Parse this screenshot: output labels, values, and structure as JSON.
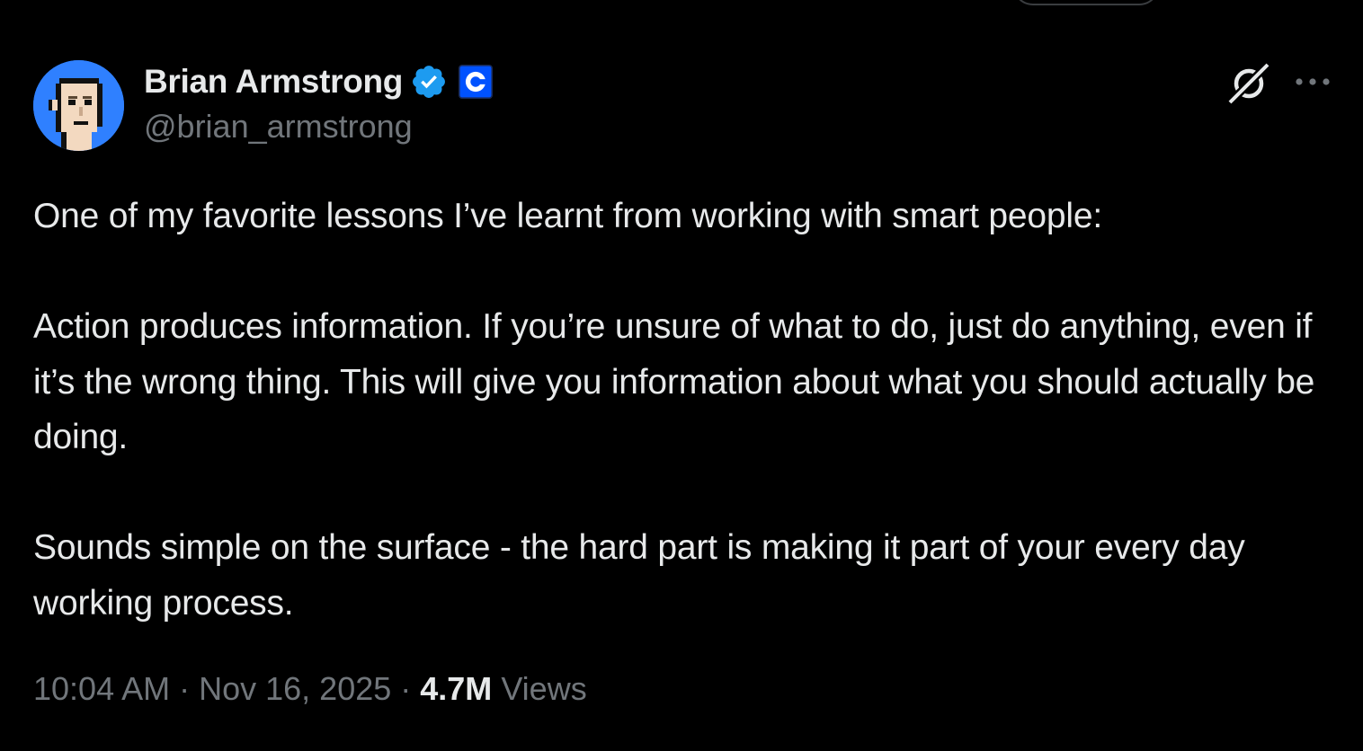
{
  "author": {
    "display_name": "Brian Armstrong",
    "handle": "@brian_armstrong",
    "verified_badge": "verified-badge-icon",
    "affiliate_badge": "coinbase-logo-icon",
    "avatar": "pixel-punk-avatar"
  },
  "actions": {
    "grok_icon": "grok-icon",
    "more_icon": "more-options-icon"
  },
  "tweet": {
    "paragraphs": [
      "One of my favorite lessons I’ve learnt from working with smart people:",
      "Action produces information. If you’re unsure of what to do, just do anything, even if it’s the wrong thing. This will give you information about what you should actually be doing.",
      "Sounds simple on the surface - the hard part is making it part of your every day working process."
    ]
  },
  "meta": {
    "time": "10:04 AM",
    "separator": " · ",
    "date": "Nov 16, 2025",
    "views_count": "4.7M",
    "views_label": " Views"
  },
  "colors": {
    "background": "#000000",
    "primary_text": "#e7e9ea",
    "secondary_text": "#71767b",
    "verified_blue": "#1d9bf0",
    "avatar_bg": "#2f80ff",
    "coinbase_blue": "#0052ff"
  }
}
